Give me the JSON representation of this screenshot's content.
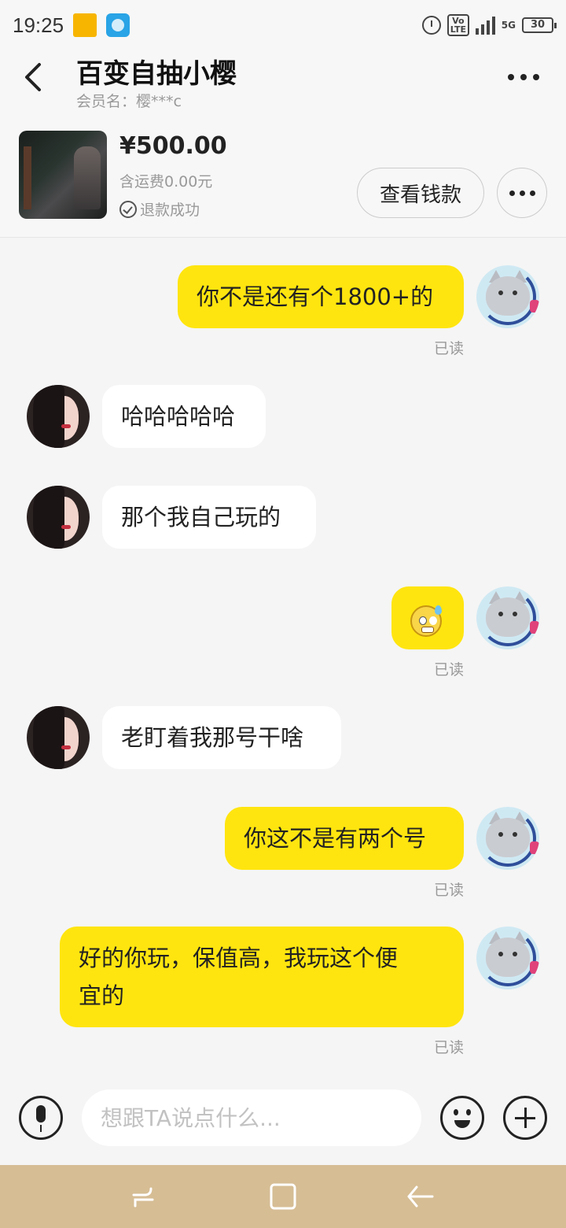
{
  "status_bar": {
    "time": "19:25",
    "network": "5G",
    "volte": "Vo LTE",
    "battery": "30"
  },
  "header": {
    "title": "百变自抽小樱",
    "subtitle": "会员名：樱***c"
  },
  "product": {
    "price": "¥500.00",
    "shipping": "含运费0.00元",
    "status": "退款成功",
    "view_money_label": "查看钱款"
  },
  "messages": [
    {
      "from": "me",
      "text": "你不是还有个1800+的",
      "read": "已读"
    },
    {
      "from": "them",
      "text": "哈哈哈哈哈"
    },
    {
      "from": "them",
      "text": "那个我自己玩的"
    },
    {
      "from": "me",
      "emoji": "anxious-face-with-sweat",
      "read": "已读"
    },
    {
      "from": "them",
      "text": "老盯着我那号干啥"
    },
    {
      "from": "me",
      "text": "你这不是有两个号",
      "read": "已读"
    },
    {
      "from": "me",
      "text_line1": "好的你玩，保值高，我玩这个便",
      "text_line2": "宜的",
      "read": "已读"
    }
  ],
  "input": {
    "placeholder": "想跟TA说点什么..."
  },
  "icons": {
    "back": "back-arrow-icon",
    "more": "more-dots-icon",
    "mic": "microphone-icon",
    "emoji": "emoji-icon",
    "plus": "plus-icon",
    "check": "check-circle-icon"
  },
  "colors": {
    "my_bubble": "#ffe50f",
    "their_bubble": "#ffffff",
    "nav_bar": "#d6bd94"
  }
}
